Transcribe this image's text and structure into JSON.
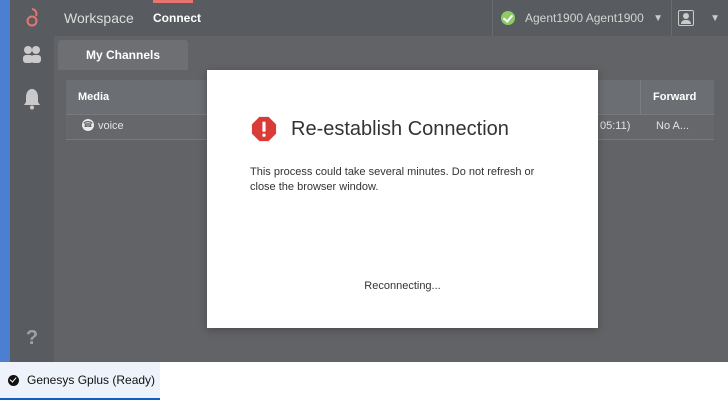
{
  "topbar": {
    "logo_icon": "genesys-logo-icon",
    "workspace_label": "Workspace",
    "connect_label": "Connect",
    "agent_name": "Agent1900 Agent1900",
    "agent_status_icon": "ready-check-icon",
    "user_menu_icon": "user-icon"
  },
  "sidebar": {
    "items": [
      {
        "icon": "contacts-icon"
      },
      {
        "icon": "bell-icon"
      },
      {
        "icon": "help-icon",
        "glyph": "?"
      }
    ]
  },
  "tabs": {
    "active_label": "My Channels"
  },
  "channels_table": {
    "columns": [
      "Media",
      "Forward"
    ],
    "rows": [
      {
        "media": "voice",
        "time_fragment": "05:11)",
        "forward": "No A..."
      }
    ]
  },
  "modal": {
    "icon": "error-icon",
    "title": "Re-establish Connection",
    "body": "This process could take several minutes. Do not refresh or close the browser window.",
    "status": "Reconnecting..."
  },
  "taskbar": {
    "label": "Genesys Gplus (Ready)"
  },
  "colors": {
    "accent": "#e0544b",
    "ready": "#6fbf40",
    "error": "#d93b37",
    "frame": "#2f3237"
  }
}
